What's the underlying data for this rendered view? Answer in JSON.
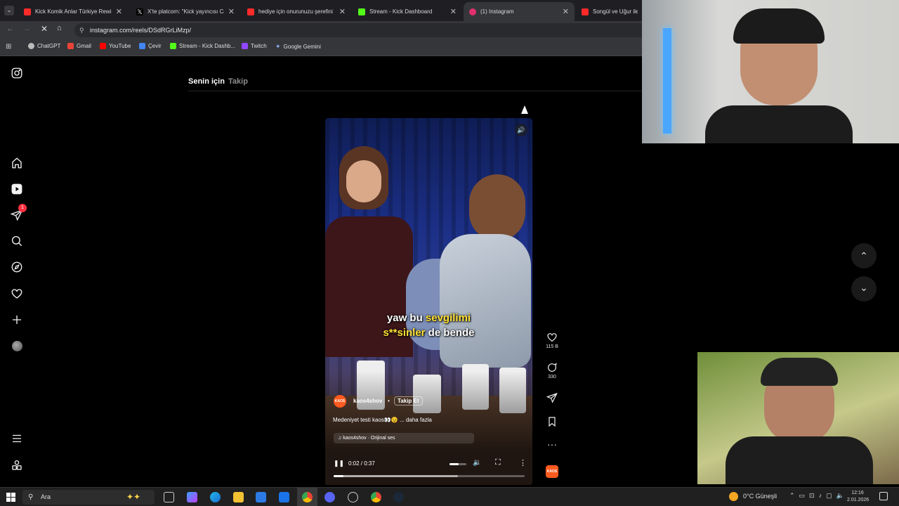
{
  "browser": {
    "tabs": [
      {
        "title": "Kick Komik Anlar Türkiye Rewin",
        "favicon_color": "#ff2a2a"
      },
      {
        "title": "X'te platcorn: \"Kick yayıncısı Ca",
        "favicon_color": "#ffffff"
      },
      {
        "title": "hediye için onurunuzu şerefini",
        "favicon_color": "#ff2a2a"
      },
      {
        "title": "Stream - Kick Dashboard",
        "favicon_color": "#53fc18"
      },
      {
        "title": "(1) Instagram",
        "favicon_color": "#e1306c"
      },
      {
        "title": "Songül ve Uğur ile S",
        "favicon_color": "#ff2a2a"
      }
    ],
    "url": "instagram.com/reels/DSdRGrLiMzp/",
    "bookmarks": [
      {
        "label": "ChatGPT",
        "color": "#bbbbbb"
      },
      {
        "label": "Gmail",
        "color": "#ea4335"
      },
      {
        "label": "YouTube",
        "color": "#ff0000"
      },
      {
        "label": "Çevir",
        "color": "#4285f4"
      },
      {
        "label": "Stream - Kick Dashb...",
        "color": "#53fc18"
      },
      {
        "label": "Twitch",
        "color": "#9146ff"
      },
      {
        "label": "Google Gemini",
        "color": "#8ab4f8"
      }
    ]
  },
  "instagram": {
    "feed_tabs": {
      "for_you": "Senin için",
      "following": "Takip"
    },
    "notification_count": "1",
    "reel": {
      "caption_line1_white": "yaw bu ",
      "caption_line1_yellow": "sevgilimi",
      "caption_line2_yellow": "s**sinler",
      "caption_line2_white": " de bende",
      "username": "kaos4shov",
      "follow_label": "Takip Et",
      "description": "Medeniyet testi kaos👀😉 ... daha fazla",
      "audio": "kaos4shov · Orijinal ses",
      "time": "0:02 / 0:37",
      "progress": 0.05,
      "volume_level": 0.55,
      "buffered": 0.65
    },
    "actions": {
      "likes": "115 B",
      "comments": "330"
    }
  },
  "taskbar": {
    "search_placeholder": "Ara",
    "weather": "0°C  Güneşli",
    "time": "12:16",
    "date": "2.01.2026"
  },
  "colors": {
    "accent": "#e1306c",
    "ig_bg": "#000000",
    "chrome_dark": "#35363a"
  }
}
